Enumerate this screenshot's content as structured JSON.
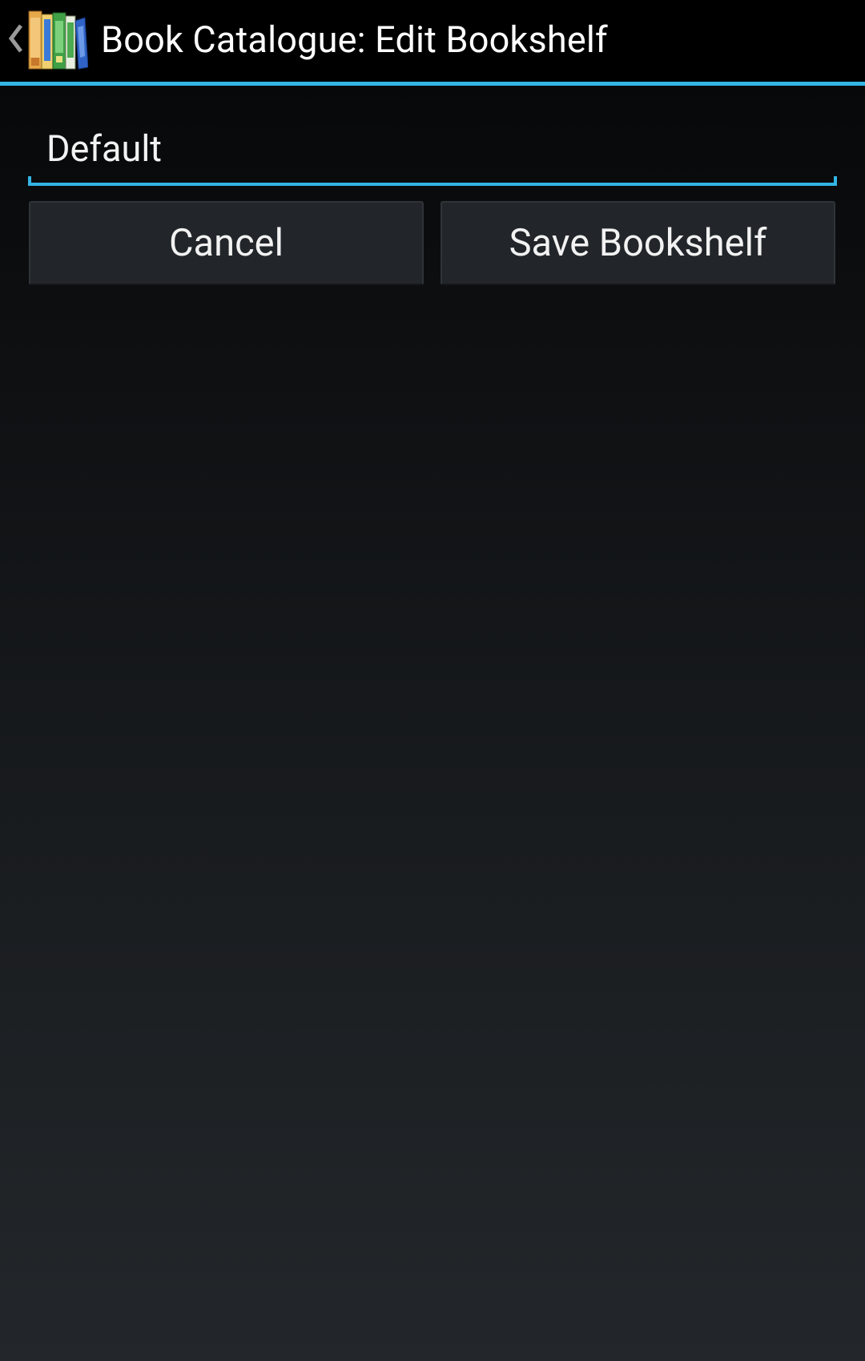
{
  "action_bar": {
    "title": "Book Catalogue: Edit Bookshelf",
    "accent_color": "#33b5e5",
    "up_icon": "chevron-left-icon",
    "app_icon": "bookshelf-app-icon"
  },
  "form": {
    "bookshelf_name_value": "Default"
  },
  "buttons": {
    "cancel_label": "Cancel",
    "save_label": "Save Bookshelf"
  }
}
